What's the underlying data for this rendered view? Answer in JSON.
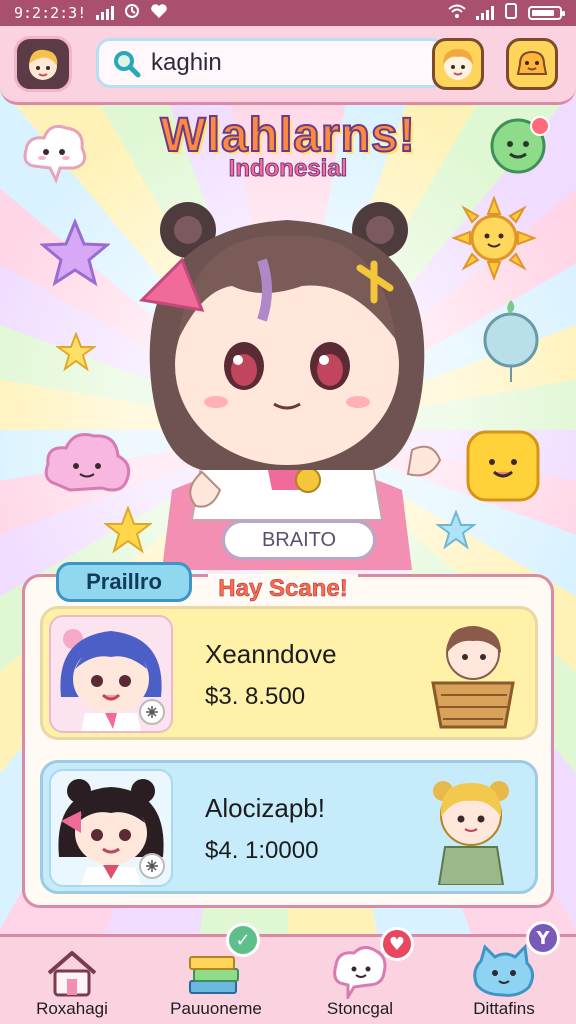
{
  "status_bar": {
    "time": "9:2:2:3!",
    "battery_level": 0.85
  },
  "header": {
    "search_value": "kaghin",
    "icons": [
      "profile-avatar-icon",
      "search-icon",
      "character-icon",
      "notification-icon"
    ]
  },
  "logo": {
    "title": "Wlahlarns!",
    "subtitle": "Indonesial"
  },
  "hero": {
    "badge": "BRAITO"
  },
  "panel": {
    "tab": "Praillro",
    "title": "Hay Scane!",
    "cards": [
      {
        "name": "Xeanndove",
        "price": "$3. 8.500"
      },
      {
        "name": "Alocizapb!",
        "price": "$4. 1:0000"
      }
    ]
  },
  "bottom_nav": {
    "items": [
      {
        "label": "Roxahagi",
        "icon": "home-icon"
      },
      {
        "label": "Pauuoneme",
        "icon": "books-icon",
        "badge": "✓"
      },
      {
        "label": "Stoncgal",
        "icon": "heart-chat-icon",
        "badge": "♥"
      },
      {
        "label": "Dittafins",
        "icon": "mascot-icon",
        "badge": "Y"
      }
    ]
  },
  "colors": {
    "status_bar": "#a8506e",
    "header": "#fbd3e0",
    "accent_pink": "#d98aa6",
    "tab_blue": "#8fd8f0",
    "card_yellow": "#fff1a8",
    "card_blue": "#c6ebfb"
  }
}
